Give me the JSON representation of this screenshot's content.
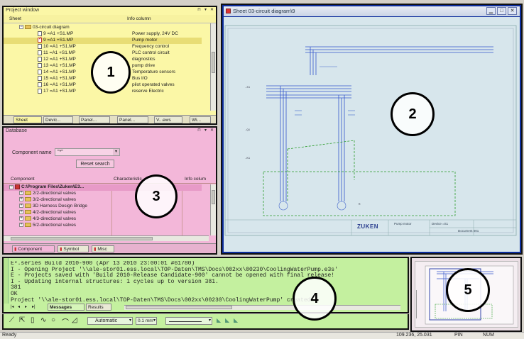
{
  "project_window": {
    "title": "Project window",
    "col_sheet": "Sheet",
    "col_info": "Info column",
    "tree": [
      {
        "label": "03-circuit diagram",
        "info": "",
        "type": "folder"
      },
      {
        "label": "9 =A1 +S1.MP",
        "info": "Power supply, 24V DC",
        "type": "page"
      },
      {
        "label": "9 =A1 +S1.MP",
        "info": "Pump motor",
        "type": "check"
      },
      {
        "label": "10 =A1 +S1.MP",
        "info": "Frequency control",
        "type": "page"
      },
      {
        "label": "11 =A1 +S1.MP",
        "info": "PLC control circuit",
        "type": "page"
      },
      {
        "label": "12 =A1 +S1.MP",
        "info": "diagnostics",
        "type": "page"
      },
      {
        "label": "13 =A1 +S1.MP",
        "info": "pump drive",
        "type": "page"
      },
      {
        "label": "14 =A1 +S1.MP",
        "info": "Temperature sensors",
        "type": "page"
      },
      {
        "label": "15 =A1 +S1.MP",
        "info": "Bus I/O",
        "type": "page"
      },
      {
        "label": "16 =A1 +S1.MP",
        "info": "pilot operated valves",
        "type": "page"
      },
      {
        "label": "17 =A1 +S1.MP",
        "info": "reserve Electric",
        "type": "page"
      }
    ],
    "tabs": [
      "Sheet",
      "Devic...",
      "Panel...",
      "Panel...",
      "V...ews",
      "Wi..."
    ]
  },
  "database": {
    "title": "Database",
    "component_name_label": "Component name",
    "component_name_value": "\"*\"",
    "reset_search": "Reset search",
    "col_component": "Component",
    "col_characteristic": "Characteristic",
    "col_info": "Info colum",
    "tree": [
      {
        "label": "C:\\Program Files\\Zuken\\E3...",
        "root": true
      },
      {
        "label": "2/2-directional valves"
      },
      {
        "label": "3/2-directional valves"
      },
      {
        "label": "3D Harness Design Bridge"
      },
      {
        "label": "4/2-directional valves"
      },
      {
        "label": "4/3-directional valves"
      },
      {
        "label": "5/2-directional valves"
      }
    ],
    "tabs": [
      "Component",
      "Symbol",
      "Misc"
    ]
  },
  "sheet_window": {
    "title": "Sheet 03-circuit diagram\\9",
    "brand": "ZUKEN",
    "tb_item_1": "Pump motor",
    "tb_item_2": "Device =S1",
    "tb_item_3": "Document 001"
  },
  "output": {
    "lines": [
      "E³.series Build 2010-900 (Apr 13 2010 23:00:01 #61780)",
      "I - Opening Project '\\\\ale-stor01.ess.local\\TOP-Daten\\TMS\\Docs\\002xx\\00230\\CoolingWaterPump.e3s'",
      "E - Projects saved with 'Build 2010-Release Candidate-900' cannot be opened with final release!",
      "I - Updating internal structures: 1 cycles up to version 381.",
      "381",
      "OK",
      "Project '\\\\ale-stor01.ess.local\\TOP-Daten\\TMS\\Docs\\002xx\\00230\\CoolingWaterPump' created"
    ],
    "tabs": [
      "Messages",
      "Results"
    ]
  },
  "toolbar": {
    "line_style": "Automatic",
    "line_width": "0.1 mm"
  },
  "status_bar": {
    "left": "Ready",
    "coords": "109.236, 25.031",
    "mode1": "PIN",
    "mode2": "NUM"
  },
  "callouts": [
    "1",
    "2",
    "3",
    "4",
    "5"
  ],
  "colors": {
    "project_bg": "#fbf7a6",
    "database_bg": "#f3b7d9",
    "sheet_bg": "#d7e6ec",
    "output_bg": "#c4f09f",
    "overview_bg": "#ece0e6",
    "frame": "#0b2c9c"
  }
}
